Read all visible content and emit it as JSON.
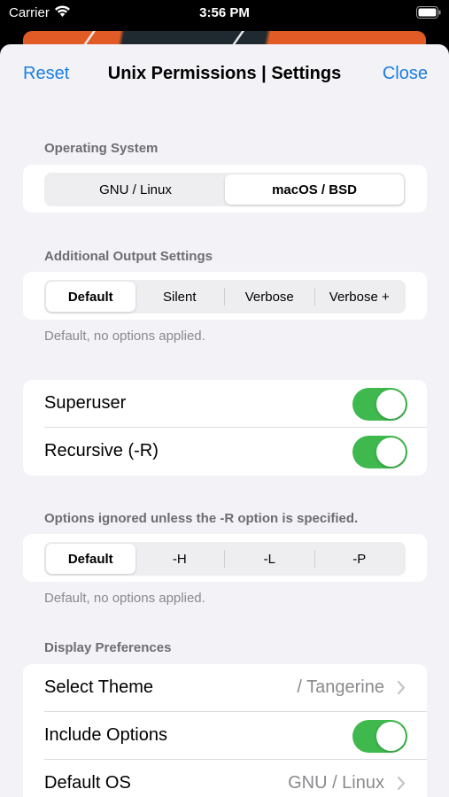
{
  "status_bar": {
    "carrier": "Carrier",
    "time": "3:56 PM"
  },
  "nav": {
    "reset_label": "Reset",
    "title": "Unix Permissions | Settings",
    "close_label": "Close"
  },
  "operating_system": {
    "header": "Operating System",
    "options": [
      "GNU / Linux",
      "macOS / BSD"
    ],
    "selected": "macOS / BSD"
  },
  "output_settings": {
    "header": "Additional Output Settings",
    "options": [
      "Default",
      "Silent",
      "Verbose",
      "Verbose +"
    ],
    "selected": "Default",
    "footer": "Default, no options applied."
  },
  "toggles": {
    "superuser_label": "Superuser",
    "superuser_on": true,
    "recursive_label": "Recursive (-R)",
    "recursive_on": true
  },
  "recursive_options": {
    "header": "Options ignored unless the -R option is specified.",
    "options": [
      "Default",
      "-H",
      "-L",
      "-P"
    ],
    "selected": "Default",
    "footer": "Default, no options applied."
  },
  "display_preferences": {
    "header": "Display Preferences",
    "select_theme_label": "Select Theme",
    "select_theme_value": "/ Tangerine",
    "include_options_label": "Include Options",
    "include_options_on": true,
    "default_os_label": "Default OS",
    "default_os_value": "GNU / Linux"
  },
  "colors": {
    "accent": "#1a7fe0",
    "toggle_on": "#3fb94d",
    "theme_orange": "#e05b25"
  }
}
